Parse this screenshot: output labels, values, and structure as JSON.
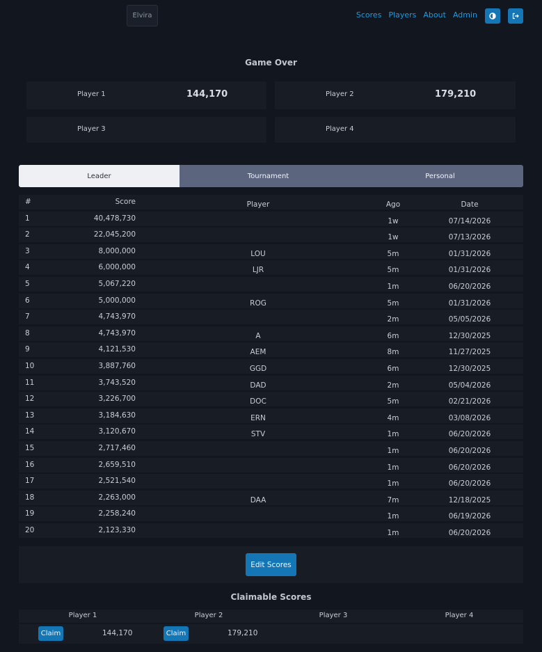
{
  "header": {
    "machine_label": "Elvira",
    "nav": [
      "Scores",
      "Players",
      "About",
      "Admin"
    ],
    "theme_icon": "contrast-icon",
    "logout_icon": "logout-icon"
  },
  "game": {
    "title": "Game Over",
    "players": [
      {
        "name": "Player 1",
        "score": "144,170"
      },
      {
        "name": "Player 2",
        "score": "179,210"
      },
      {
        "name": "Player 3",
        "score": ""
      },
      {
        "name": "Player 4",
        "score": ""
      }
    ]
  },
  "tabs": [
    "Leader",
    "Tournament",
    "Personal"
  ],
  "table": {
    "headers": [
      "#",
      "Score",
      "Player",
      "Ago",
      "Date"
    ],
    "rows": [
      {
        "rank": "1",
        "score": "40,478,730",
        "player": "",
        "ago": "1w",
        "date": "07/14/2026"
      },
      {
        "rank": "2",
        "score": "22,045,200",
        "player": "",
        "ago": "1w",
        "date": "07/13/2026"
      },
      {
        "rank": "3",
        "score": "8,000,000",
        "player": "LOU",
        "ago": "5m",
        "date": "01/31/2026"
      },
      {
        "rank": "4",
        "score": "6,000,000",
        "player": "LJR",
        "ago": "5m",
        "date": "01/31/2026"
      },
      {
        "rank": "5",
        "score": "5,067,220",
        "player": "",
        "ago": "1m",
        "date": "06/20/2026"
      },
      {
        "rank": "6",
        "score": "5,000,000",
        "player": "ROG",
        "ago": "5m",
        "date": "01/31/2026"
      },
      {
        "rank": "7",
        "score": "4,743,970",
        "player": "",
        "ago": "2m",
        "date": "05/05/2026"
      },
      {
        "rank": "8",
        "score": "4,743,970",
        "player": "A",
        "ago": "6m",
        "date": "12/30/2025"
      },
      {
        "rank": "9",
        "score": "4,121,530",
        "player": "AEM",
        "ago": "8m",
        "date": "11/27/2025"
      },
      {
        "rank": "10",
        "score": "3,887,760",
        "player": "GGD",
        "ago": "6m",
        "date": "12/30/2025"
      },
      {
        "rank": "11",
        "score": "3,743,520",
        "player": "DAD",
        "ago": "2m",
        "date": "05/04/2026"
      },
      {
        "rank": "12",
        "score": "3,226,700",
        "player": "DOC",
        "ago": "5m",
        "date": "02/21/2026"
      },
      {
        "rank": "13",
        "score": "3,184,630",
        "player": "ERN",
        "ago": "4m",
        "date": "03/08/2026"
      },
      {
        "rank": "14",
        "score": "3,120,670",
        "player": "STV",
        "ago": "1m",
        "date": "06/20/2026"
      },
      {
        "rank": "15",
        "score": "2,717,460",
        "player": "",
        "ago": "1m",
        "date": "06/20/2026"
      },
      {
        "rank": "16",
        "score": "2,659,510",
        "player": "",
        "ago": "1m",
        "date": "06/20/2026"
      },
      {
        "rank": "17",
        "score": "2,521,540",
        "player": "",
        "ago": "1m",
        "date": "06/20/2026"
      },
      {
        "rank": "18",
        "score": "2,263,000",
        "player": "DAA",
        "ago": "7m",
        "date": "12/18/2025"
      },
      {
        "rank": "19",
        "score": "2,258,240",
        "player": "",
        "ago": "1m",
        "date": "06/19/2026"
      },
      {
        "rank": "20",
        "score": "2,123,330",
        "player": "",
        "ago": "1m",
        "date": "06/20/2026"
      }
    ]
  },
  "edit_label": "Edit Scores",
  "claimable": {
    "title": "Claimable Scores",
    "headers": [
      "Player 1",
      "Player 2",
      "Player 3",
      "Player 4"
    ],
    "claim_label": "Claim",
    "values": [
      "144,170",
      "179,210"
    ]
  },
  "colors": {
    "background": "#12161e",
    "accent": "#1576b6",
    "link": "#1c9be0"
  }
}
